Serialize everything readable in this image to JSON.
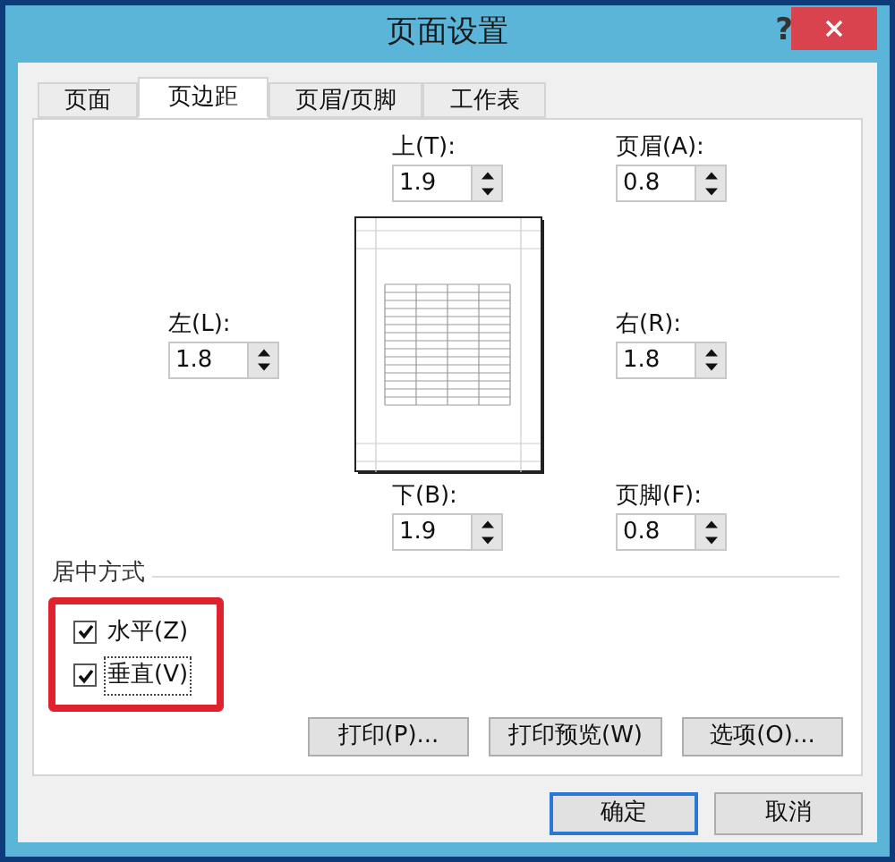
{
  "window": {
    "title": "页面设置",
    "help": "?"
  },
  "tabs": [
    {
      "label": "页面",
      "selected": false
    },
    {
      "label": "页边距",
      "selected": true
    },
    {
      "label": "页眉/页脚",
      "selected": false
    },
    {
      "label": "工作表",
      "selected": false
    }
  ],
  "margins": {
    "top": {
      "label": "上(T):",
      "value": "1.9"
    },
    "header": {
      "label": "页眉(A):",
      "value": "0.8"
    },
    "left": {
      "label": "左(L):",
      "value": "1.8"
    },
    "right": {
      "label": "右(R):",
      "value": "1.8"
    },
    "bottom": {
      "label": "下(B):",
      "value": "1.9"
    },
    "footer": {
      "label": "页脚(F):",
      "value": "0.8"
    }
  },
  "center_on_page": {
    "title": "居中方式",
    "options": [
      {
        "label": "水平(Z)",
        "checked": true,
        "focused": false
      },
      {
        "label": "垂直(V)",
        "checked": true,
        "focused": true
      }
    ]
  },
  "panel_buttons": [
    "打印(P)...",
    "打印预览(W)",
    "选项(O)..."
  ],
  "dialog_buttons": [
    {
      "label": "确定",
      "selected": true
    },
    {
      "label": "取消",
      "selected": false
    }
  ]
}
